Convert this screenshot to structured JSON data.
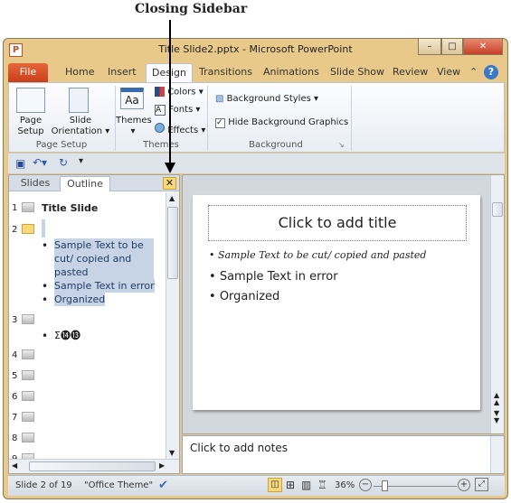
{
  "annotation": {
    "caption": "Closing Sidebar"
  },
  "window": {
    "title": "Title Slide2.pptx  -  Microsoft PowerPoint",
    "app_icon": "P",
    "controls": [
      "minimize",
      "maximize",
      "close"
    ]
  },
  "ribbon_tabs": [
    "File",
    "Home",
    "Insert",
    "Design",
    "Transitions",
    "Animations",
    "Slide Show",
    "Review",
    "View"
  ],
  "active_tab": "Design",
  "ribbon": {
    "page_setup": {
      "page_setup": "Page Setup",
      "slide_orientation": "Slide Orientation",
      "label": "Page Setup"
    },
    "themes": {
      "themes": "Themes",
      "colors": "Colors",
      "fonts": "Fonts",
      "effects": "Effects",
      "label": "Themes"
    },
    "background": {
      "background_styles": "Background Styles",
      "hide_bg": "Hide Background Graphics",
      "hide_bg_checked": true,
      "label": "Background"
    }
  },
  "panel": {
    "tabs": [
      "Slides",
      "Outline"
    ],
    "active": "Outline",
    "close_icon": "close-icon",
    "slides": [
      {
        "num": "1",
        "title": "Title Slide"
      },
      {
        "num": "2",
        "bullets": [
          "Sample Text to be cut/ copied and pasted",
          "Sample Text in error",
          "Organized"
        ],
        "selected": true
      },
      {
        "num": "3",
        "bullets": [
          "Σ⓮⓭"
        ]
      },
      {
        "num": "4"
      },
      {
        "num": "5"
      },
      {
        "num": "6"
      },
      {
        "num": "7"
      },
      {
        "num": "8"
      },
      {
        "num": "9"
      }
    ]
  },
  "slide": {
    "title_placeholder": "Click to add title",
    "bullets": [
      "Sample Text to be cut/ copied and pasted",
      "Sample Text in error",
      "Organized"
    ]
  },
  "notes": {
    "placeholder": "Click to add notes"
  },
  "status": {
    "slide": "Slide 2 of 19",
    "theme": "\"Office Theme\"",
    "zoom": "36%",
    "zoom_percent": 36
  }
}
